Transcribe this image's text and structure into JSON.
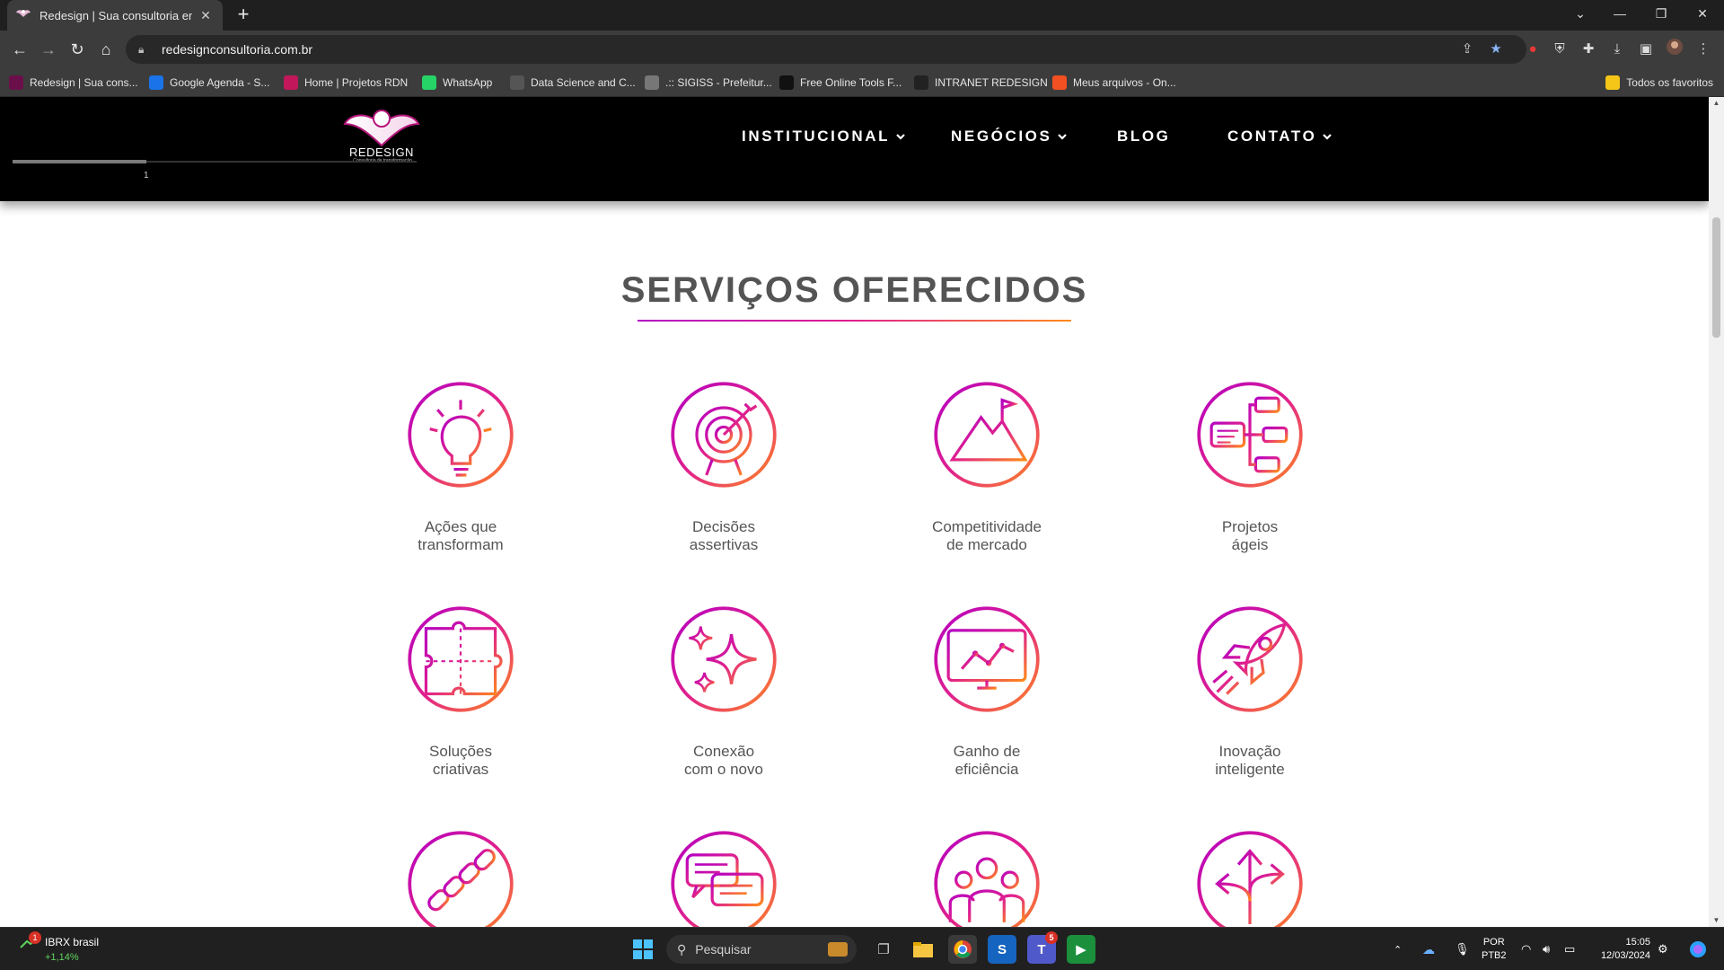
{
  "browser": {
    "tab": {
      "title": "Redesign | Sua consultoria empr",
      "close": "✕"
    },
    "new_tab": "+",
    "address": "redesignconsultoria.com.br",
    "bookmarks": [
      {
        "label": "Redesign | Sua cons...",
        "icon": "redesign-icon",
        "color": "#6b0f4a"
      },
      {
        "label": "Google Agenda - S...",
        "icon": "calendar-icon",
        "color": "#1a73e8"
      },
      {
        "label": "Home | Projetos RDN",
        "icon": "rdn-icon",
        "color": "#c2185b"
      },
      {
        "label": "WhatsApp",
        "icon": "whatsapp-icon",
        "color": "#25d366"
      },
      {
        "label": "Data Science and C...",
        "icon": "datascience-icon",
        "color": "#555555"
      },
      {
        "label": ".:: SIGISS - Prefeitur...",
        "icon": "sigiss-icon",
        "color": "#777777"
      },
      {
        "label": "Free Online Tools F...",
        "icon": "ff-icon",
        "color": "#111111"
      },
      {
        "label": "INTRANET REDESIGN",
        "icon": "intranet-icon",
        "color": "#222222"
      },
      {
        "label": "Meus arquivos - On...",
        "icon": "microsoft-icon",
        "color": "#f25022"
      }
    ],
    "all_bookmarks": "Todos os favoritos"
  },
  "site": {
    "logo_word": "REDESIGN",
    "logo_sub": "Consultoria de transformação",
    "progress_mark": "1",
    "progress_value": 0.33,
    "menu": [
      {
        "label": "INSTITUCIONAL",
        "dropdown": true
      },
      {
        "label": "NEGÓCIOS",
        "dropdown": true
      },
      {
        "label": "BLOG",
        "dropdown": false
      },
      {
        "label": "CONTATO",
        "dropdown": true
      }
    ],
    "section_title": "SERVIÇOS OFERECIDOS",
    "services": [
      {
        "line1": "Ações que",
        "line2": "transformam",
        "icon": "lightbulb-icon"
      },
      {
        "line1": "Decisões",
        "line2": "assertivas",
        "icon": "target-icon"
      },
      {
        "line1": "Competitividade",
        "line2": "de mercado",
        "icon": "mountain-flag-icon"
      },
      {
        "line1": "Projetos",
        "line2": "ágeis",
        "icon": "flowchart-icon"
      },
      {
        "line1": "Soluções",
        "line2": "criativas",
        "icon": "puzzle-icon"
      },
      {
        "line1": "Conexão",
        "line2": "com o novo",
        "icon": "sparkles-icon"
      },
      {
        "line1": "Ganho de",
        "line2": "eficiência",
        "icon": "monitor-chart-icon"
      },
      {
        "line1": "Inovação",
        "line2": "inteligente",
        "icon": "rocket-icon"
      },
      {
        "line1": "",
        "line2": "",
        "icon": "chain-icon"
      },
      {
        "line1": "",
        "line2": "",
        "icon": "chat-bubbles-icon"
      },
      {
        "line1": "",
        "line2": "",
        "icon": "team-icon"
      },
      {
        "line1": "",
        "line2": "",
        "icon": "split-arrows-icon"
      }
    ],
    "gradient": {
      "start": "#b300c4",
      "mid": "#e0208e",
      "end": "#ff8a1a"
    }
  },
  "taskbar": {
    "widget_title": "IBRX brasil",
    "widget_value": "+1,14%",
    "widget_badge": "1",
    "search_placeholder": "Pesquisar",
    "teams_badge": "5",
    "lang_line1": "POR",
    "lang_line2": "PTB2",
    "time": "15:05",
    "date": "12/03/2024"
  }
}
